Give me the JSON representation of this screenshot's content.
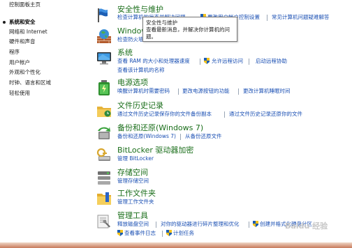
{
  "sidebar": {
    "items": [
      {
        "label": "控制面板主页"
      },
      {
        "label": "系统和安全"
      },
      {
        "label": "网络和 Internet"
      },
      {
        "label": "硬件和声音"
      },
      {
        "label": "程序"
      },
      {
        "label": "用户帐户"
      },
      {
        "label": "外观和个性化"
      },
      {
        "label": "时钟、语言和区域"
      },
      {
        "label": "轻松使用"
      }
    ]
  },
  "sections": {
    "security": {
      "title": "安全性与维护",
      "links": [
        "检查计算机的状态并解决问题",
        "更改用户帐户控制设置",
        "常见计算机问题疑难解答"
      ]
    },
    "firewall": {
      "title": "Window",
      "links": [
        "检查防火墙"
      ]
    },
    "system": {
      "title": "系统",
      "links": [
        "查看 RAM 的大小和处理器速度",
        "允许远程访问",
        "启动远程协助",
        "查看该计算机的名称"
      ]
    },
    "power": {
      "title": "电源选项",
      "links": [
        "唤醒计算机时需要密码",
        "更改电源按钮的功能",
        "更改计算机睡眠时间"
      ]
    },
    "history": {
      "title": "文件历史记录",
      "links": [
        "通过文件历史记录保存你的文件备份副本",
        "通过文件历史记录还原你的文件"
      ]
    },
    "backup": {
      "title": "备份和还原(Windows 7)",
      "links": [
        "备份和还原(Windows 7)",
        "从备份还原文件"
      ]
    },
    "bitlocker": {
      "title": "BitLocker 驱动器加密",
      "links": [
        "管理 BitLocker"
      ]
    },
    "storage": {
      "title": "存储空间",
      "links": [
        "管理存储空间"
      ]
    },
    "workfolders": {
      "title": "工作文件夹",
      "links": [
        "管理工作文件夹"
      ]
    },
    "admin": {
      "title": "管理工具",
      "links": [
        "释放磁盘空间",
        "对你的驱动器进行碎片整理和优化",
        "创建并格式化硬盘分区",
        "查看事件日志",
        "计划任务"
      ]
    }
  },
  "tooltip": {
    "line1": "安全性与维护",
    "line2": "查看最新消息，并解决你计算机的问",
    "line3": "题。"
  },
  "watermark": "Baidu 经验",
  "colors": {
    "title": "#1a6e1a",
    "link": "#1a4fb3"
  }
}
